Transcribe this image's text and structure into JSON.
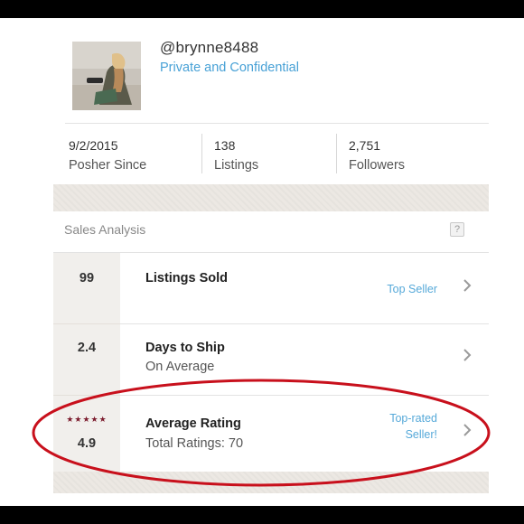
{
  "profile": {
    "username": "@brynne8488",
    "privacy_link": "Private and Confidential",
    "avatar": "profile-photo"
  },
  "stats": [
    {
      "value": "9/2/2015",
      "label": "Posher Since"
    },
    {
      "value": "138",
      "label": "Listings"
    },
    {
      "value": "2,751",
      "label": "Followers"
    }
  ],
  "sales": {
    "title": "Sales Analysis",
    "help": "?",
    "rows": [
      {
        "value": "99",
        "title": "Listings Sold",
        "subtitle": "",
        "badge": "Top Seller",
        "icon": "chevron-right-icon"
      },
      {
        "value": "2.4",
        "title": "Days to Ship",
        "subtitle": "On Average",
        "badge": "",
        "icon": "chevron-right-icon"
      },
      {
        "value": "4.9",
        "stars": "★★★★★",
        "rating_stars": 5,
        "title": "Average Rating",
        "subtitle": "Total Ratings: 70",
        "badge_line1": "Top-rated",
        "badge_line2": "Seller!",
        "icon": "chevron-right-icon"
      }
    ]
  },
  "colors": {
    "link": "#48a1d6",
    "star": "#7c1c2e",
    "highlight_ring": "#c8101c",
    "band": "#ece8e3"
  }
}
